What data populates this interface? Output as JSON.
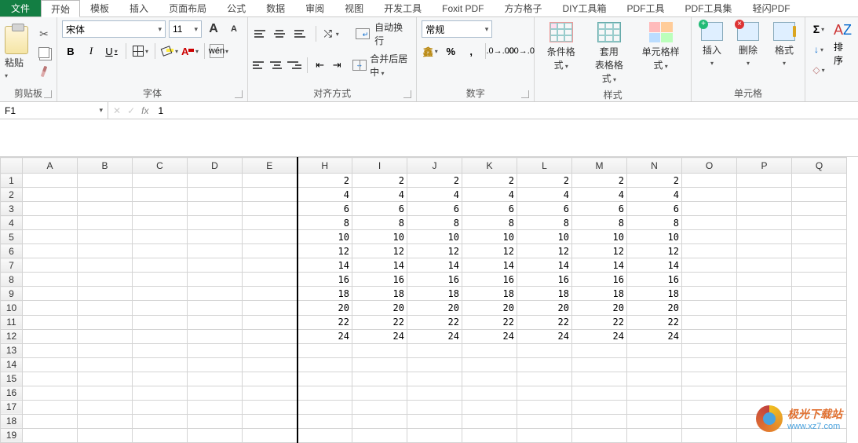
{
  "tabs": {
    "file": "文件",
    "items": [
      "开始",
      "模板",
      "插入",
      "页面布局",
      "公式",
      "数据",
      "审阅",
      "视图",
      "开发工具",
      "Foxit PDF",
      "方方格子",
      "DIY工具箱",
      "PDF工具",
      "PDF工具集",
      "轻闪PDF"
    ],
    "active": 0
  },
  "clipboard": {
    "group_label": "剪贴板",
    "paste": "粘贴"
  },
  "font": {
    "group_label": "字体",
    "name": "宋体",
    "size": "11",
    "wen": "wén"
  },
  "align": {
    "group_label": "对齐方式",
    "wrap": "自动换行",
    "merge": "合并后居中"
  },
  "number": {
    "group_label": "数字",
    "format": "常规"
  },
  "styles": {
    "group_label": "样式",
    "cond": "条件格式",
    "table": "套用\n表格格式",
    "cell": "单元格样式"
  },
  "cells": {
    "group_label": "单元格",
    "insert": "插入",
    "delete": "删除",
    "format": "格式"
  },
  "editing": {
    "sort": "排序"
  },
  "name_box": "F1",
  "formula": "1",
  "columns": [
    "A",
    "B",
    "C",
    "D",
    "E",
    "H",
    "I",
    "J",
    "K",
    "L",
    "M",
    "N",
    "O",
    "P",
    "Q"
  ],
  "row_nums": [
    1,
    2,
    3,
    4,
    5,
    6,
    7,
    8,
    9,
    10,
    11,
    12,
    13,
    14,
    15,
    16,
    17,
    18,
    19
  ],
  "grid_data": {
    "cols": [
      "H",
      "I",
      "J",
      "K",
      "L",
      "M",
      "N"
    ],
    "rows": [
      [
        2,
        2,
        2,
        2,
        2,
        2,
        2
      ],
      [
        4,
        4,
        4,
        4,
        4,
        4,
        4
      ],
      [
        6,
        6,
        6,
        6,
        6,
        6,
        6
      ],
      [
        8,
        8,
        8,
        8,
        8,
        8,
        8
      ],
      [
        10,
        10,
        10,
        10,
        10,
        10,
        10
      ],
      [
        12,
        12,
        12,
        12,
        12,
        12,
        12
      ],
      [
        14,
        14,
        14,
        14,
        14,
        14,
        14
      ],
      [
        16,
        16,
        16,
        16,
        16,
        16,
        16
      ],
      [
        18,
        18,
        18,
        18,
        18,
        18,
        18
      ],
      [
        20,
        20,
        20,
        20,
        20,
        20,
        20
      ],
      [
        22,
        22,
        22,
        22,
        22,
        22,
        22
      ],
      [
        24,
        24,
        24,
        24,
        24,
        24,
        24
      ]
    ]
  },
  "watermark": {
    "title": "极光下载站",
    "url": "www.xz7.com"
  }
}
